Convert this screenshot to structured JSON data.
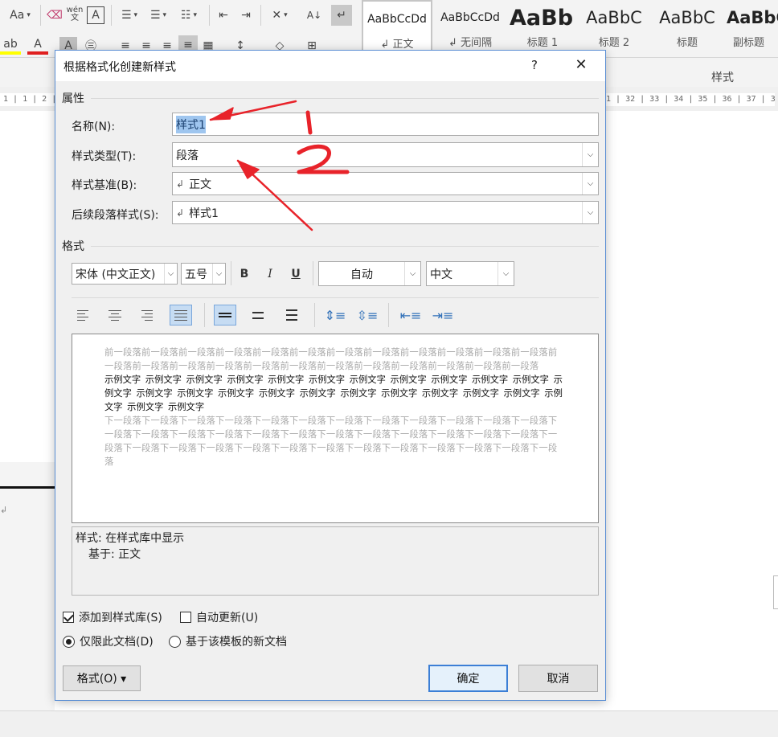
{
  "ribbon": {
    "tools_row1": [
      "Aa",
      "ab",
      "wén",
      "A",
      "≔",
      "≔",
      "≔",
      "⇤",
      "⇥",
      "⤧",
      "A↓",
      "↵"
    ],
    "styles": [
      {
        "preview": "AaBbCcDd",
        "caption": "↲ 正文",
        "selected": true
      },
      {
        "preview": "AaBbCcDd",
        "caption": "↲ 无间隔",
        "selected": false
      },
      {
        "preview": "AaBb",
        "caption": "标题 1",
        "selected": false
      },
      {
        "preview": "AaBbC",
        "caption": "标题 2",
        "selected": false
      },
      {
        "preview": "AaBbC",
        "caption": "标题",
        "selected": false
      },
      {
        "preview": "AaBbC",
        "caption": "副标题",
        "selected": false
      }
    ],
    "styles_group_label": "样式"
  },
  "ruler": {
    "left": "1 | 1 | 2 | 3",
    "right": "1 | 32 | 33 | 34 | 35 | 36 | 37 | 38 | 39 |"
  },
  "dialog": {
    "title": "根据格式化创建新样式",
    "help": "?",
    "close": "✕",
    "properties_label": "属性",
    "name_label": "名称(N):",
    "name_value": "样式1",
    "type_label": "样式类型(T):",
    "type_value": "段落",
    "based_on_label": "样式基准(B):",
    "based_on_value": "正文",
    "next_label": "后续段落样式(S):",
    "next_value": "样式1",
    "format_label": "格式",
    "font_value": "宋体 (中文正文)",
    "size_value": "五号",
    "bold": "B",
    "italic": "I",
    "underline": "U",
    "color_value": "自动",
    "lang_value": "中文",
    "preview": {
      "before": "前一段落前一段落前一段落前一段落前一段落前一段落前一段落前一段落前一段落前一段落前一段落前一段落前一段落前一段落前一段落前一段落前一段落前一段落前一段落前一段落前一段落前一段落前一段落前一段落",
      "sample": "示例文字 示例文字 示例文字 示例文字 示例文字 示例文字 示例文字 示例文字 示例文字 示例文字 示例文字 示例文字 示例文字 示例文字 示例文字 示例文字 示例文字 示例文字 示例文字 示例文字 示例文字 示例文字 示例文字 示例文字 示例文字",
      "after": "下一段落下一段落下一段落下一段落下一段落下一段落下一段落下一段落下一段落下一段落下一段落下一段落下一段落下一段落下一段落下一段落下一段落下一段落下一段落下一段落下一段落下一段落下一段落下一段落下一段落下一段落下一段落下一段落下一段落下一段落下一段落下一段落下一段落下一段落下一段落下一段落下一段落"
    },
    "description_line1": "样式: 在样式库中显示",
    "description_line2": "基于: 正文",
    "add_to_gallery": "添加到样式库(S)",
    "auto_update": "自动更新(U)",
    "this_doc_only": "仅限此文档(D)",
    "new_docs_template": "基于该模板的新文档",
    "format_button": "格式(O) ▾",
    "ok": "确定",
    "cancel": "取消"
  },
  "annotations": {
    "label_1": "1",
    "label_2": "2",
    "color": "#e8232a"
  }
}
